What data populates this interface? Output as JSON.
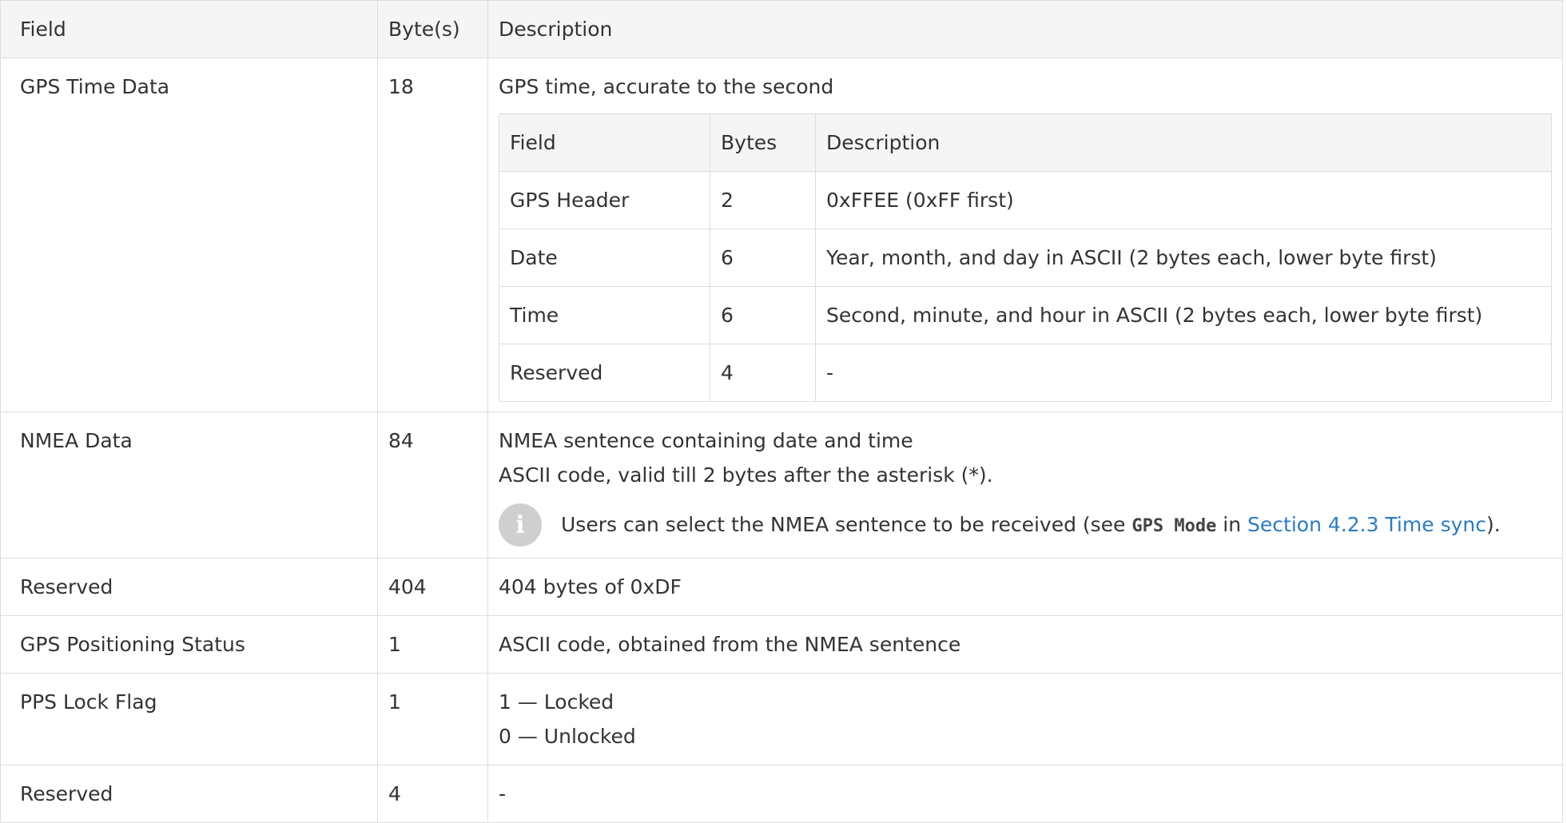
{
  "table": {
    "headers": [
      "Field",
      "Byte(s)",
      "Description"
    ],
    "rows": {
      "gps_time": {
        "field": "GPS Time Data",
        "bytes": "18",
        "desc": "GPS time, accurate to the second",
        "inner": {
          "headers": [
            "Field",
            "Bytes",
            "Description"
          ],
          "rows": [
            {
              "field": "GPS Header",
              "bytes": "2",
              "desc": "0xFFEE (0xFF first)"
            },
            {
              "field": "Date",
              "bytes": "6",
              "desc": "Year, month, and day in ASCII (2 bytes each, lower byte first)"
            },
            {
              "field": "Time",
              "bytes": "6",
              "desc": "Second, minute, and hour in ASCII (2 bytes each, lower byte first)"
            },
            {
              "field": "Reserved",
              "bytes": "4",
              "desc": "-"
            }
          ]
        }
      },
      "nmea": {
        "field": "NMEA Data",
        "bytes": "84",
        "line1": "NMEA sentence containing date and time",
        "line2": "ASCII code, valid till 2 bytes after the asterisk (*).",
        "note_pre": "Users can select the NMEA sentence to be received (see ",
        "note_code": "GPS Mode",
        "note_mid": " in ",
        "note_link": "Section 4.2.3 Time sync",
        "note_post": ")."
      },
      "reserved1": {
        "field": "Reserved",
        "bytes": "404",
        "desc": "404 bytes of 0xDF"
      },
      "gps_status": {
        "field": "GPS Positioning Status",
        "bytes": "1",
        "desc": "ASCII code, obtained from the NMEA sentence"
      },
      "pps": {
        "field": "PPS Lock Flag",
        "bytes": "1",
        "line1": "1 — Locked",
        "line2": "0 — Unlocked"
      },
      "reserved2": {
        "field": "Reserved",
        "bytes": "4",
        "desc": "-"
      }
    }
  },
  "icons": {
    "info": "info-icon",
    "info_glyph": "i"
  },
  "colors": {
    "link": "#2b7bc4",
    "header_bg": "#f5f5f5",
    "border": "#dddddd"
  }
}
